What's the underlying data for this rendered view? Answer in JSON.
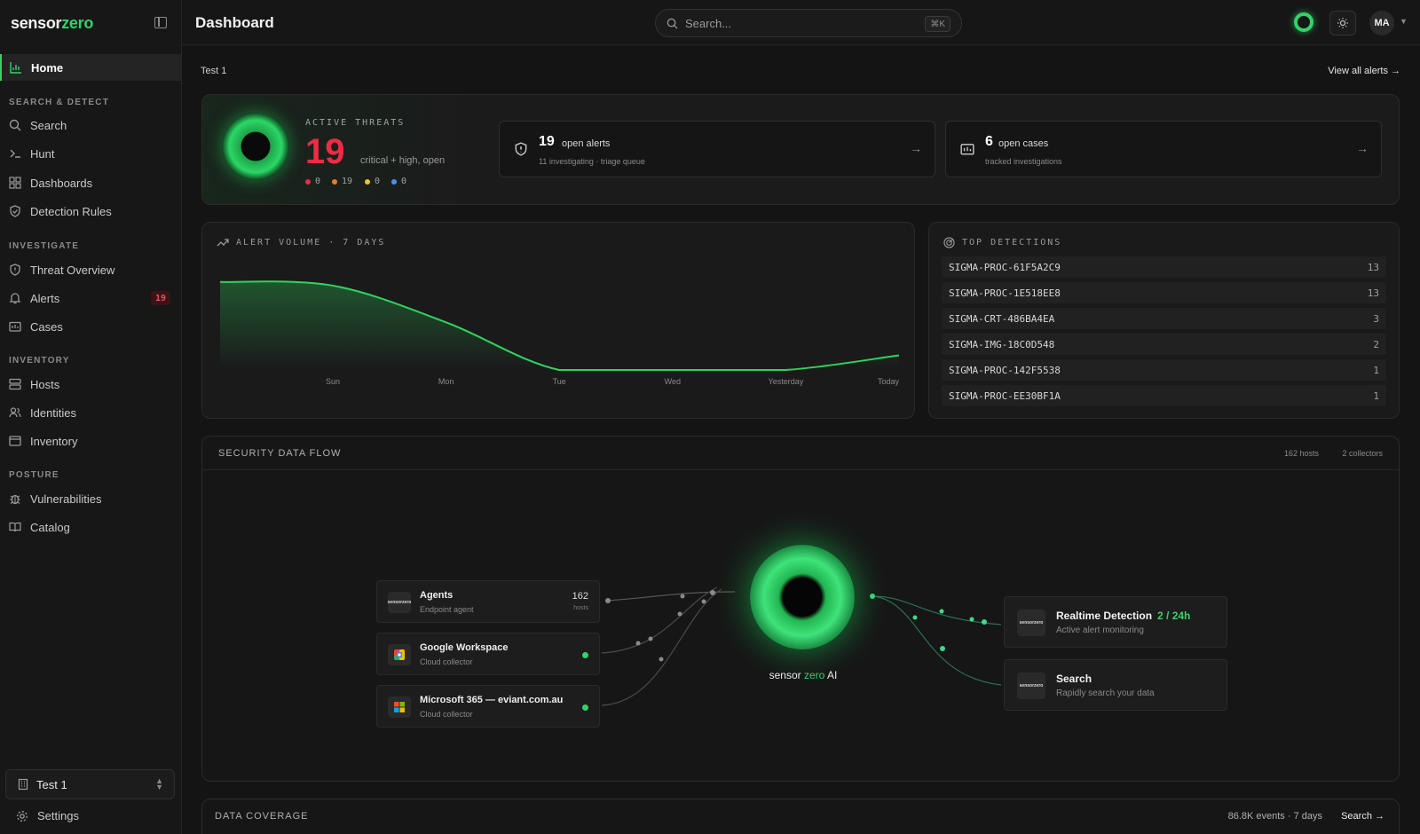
{
  "app": {
    "brand_main": "sensor",
    "brand_accent": "zero",
    "accent_color": "#34d26a",
    "danger_color": "#ef2b45"
  },
  "sidebar": {
    "home": "Home",
    "sections": {
      "search_detect": "SEARCH & DETECT",
      "investigate": "INVESTIGATE",
      "inventory": "INVENTORY",
      "posture": "POSTURE"
    },
    "items": {
      "search": "Search",
      "hunt": "Hunt",
      "dashboards": "Dashboards",
      "detection_rules": "Detection Rules",
      "threat_overview": "Threat Overview",
      "alerts": "Alerts",
      "alerts_badge": "19",
      "cases": "Cases",
      "hosts": "Hosts",
      "identities": "Identities",
      "inventory": "Inventory",
      "vulnerabilities": "Vulnerabilities",
      "catalog": "Catalog"
    },
    "tenant": "Test 1",
    "settings": "Settings"
  },
  "topbar": {
    "title": "Dashboard",
    "search_placeholder": "Search...",
    "shortcut": "⌘K",
    "avatar": "MA"
  },
  "main": {
    "breadcrumb": "Test 1",
    "view_all": "View all alerts →",
    "threats": {
      "label": "ACTIVE THREATS",
      "count": "19",
      "sub": "critical + high, open",
      "severity": [
        {
          "value": "0",
          "color": "#ef2b45"
        },
        {
          "value": "19",
          "color": "#f07a2b"
        },
        {
          "value": "0",
          "color": "#f0c22b"
        },
        {
          "value": "0",
          "color": "#4a8ff0"
        }
      ]
    },
    "open_alerts": {
      "num": "19",
      "label": "open alerts",
      "desc": "11 investigating · triage queue"
    },
    "open_cases": {
      "num": "6",
      "label": "open cases",
      "desc": "tracked investigations"
    },
    "volume": {
      "title": "ALERT VOLUME · 7 DAYS"
    },
    "detections": {
      "title": "TOP DETECTIONS",
      "rows": [
        {
          "name": "SIGMA-PROC-61F5A2C9",
          "count": "13"
        },
        {
          "name": "SIGMA-PROC-1E518EE8",
          "count": "13"
        },
        {
          "name": "SIGMA-CRT-486BA4EA",
          "count": "3"
        },
        {
          "name": "SIGMA-IMG-18C0D548",
          "count": "2"
        },
        {
          "name": "SIGMA-PROC-142F5538",
          "count": "1"
        },
        {
          "name": "SIGMA-PROC-EE30BF1A",
          "count": "1"
        }
      ]
    },
    "flow": {
      "title": "SECURITY DATA FLOW",
      "hosts": "162 hosts",
      "collectors": "2 collectors",
      "sources": [
        {
          "name": "Agents",
          "sub": "Endpoint agent",
          "count": "162",
          "count_sub": "hosts"
        },
        {
          "name": "Google Workspace",
          "sub": "Cloud collector"
        },
        {
          "name": "Microsoft 365 — eviant.com.au",
          "sub": "Cloud collector"
        }
      ],
      "logo_text": "sensorzero",
      "ai_main": "sensor",
      "ai_accent": "zero",
      "ai_tail": "AI",
      "destinations": [
        {
          "name": "Realtime Detection",
          "rate": "2 / 24h",
          "sub": "Active alert monitoring"
        },
        {
          "name": "Search",
          "sub": "Rapidly search your data"
        }
      ]
    },
    "coverage": {
      "title": "DATA COVERAGE",
      "meta": "86.8K events · 7 days",
      "link": "Search →"
    }
  },
  "chart_data": {
    "type": "area",
    "title": "ALERT VOLUME · 7 DAYS",
    "categories": [
      "Sun",
      "Mon",
      "Tue",
      "Wed",
      "Yesterday",
      "Today"
    ],
    "start_value": 24,
    "values": [
      23,
      13,
      0,
      0,
      0,
      4
    ],
    "ylim": [
      0,
      30
    ],
    "color": "#2fd35e",
    "grid": false
  }
}
